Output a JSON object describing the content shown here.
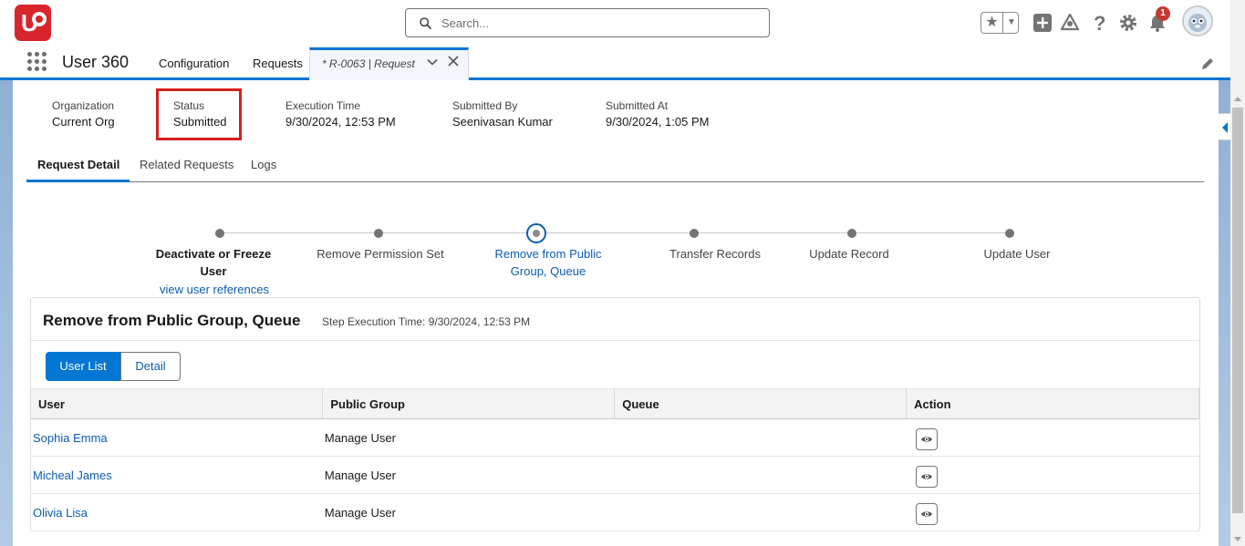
{
  "topbar": {
    "logo_text": "U",
    "search_placeholder": "Search...",
    "notification_count": "1"
  },
  "nav": {
    "app_name": "User 360",
    "items": [
      "Configuration",
      "Requests"
    ],
    "active_tab": "* R-0063 | Request"
  },
  "header": {
    "fields": [
      {
        "label": "Organization",
        "value": "Current Org"
      },
      {
        "label": "Status",
        "value": "Submitted"
      },
      {
        "label": "Execution Time",
        "value": "9/30/2024, 12:53 PM"
      },
      {
        "label": "Submitted By",
        "value": "Seenivasan Kumar"
      },
      {
        "label": "Submitted At",
        "value": "9/30/2024, 1:05 PM"
      }
    ]
  },
  "tabs": [
    "Request Detail",
    "Related Requests",
    "Logs"
  ],
  "path": {
    "steps": [
      {
        "label": "Deactivate or Freeze User",
        "state": "done"
      },
      {
        "label": "Remove Permission Set",
        "state": "pending"
      },
      {
        "label": "Remove from Public Group, Queue",
        "state": "current"
      },
      {
        "label": "Transfer Records",
        "state": "pending"
      },
      {
        "label": "Update Record",
        "state": "pending"
      },
      {
        "label": "Update User",
        "state": "pending"
      }
    ],
    "step1_link": "view user references"
  },
  "card": {
    "title": "Remove from Public Group, Queue",
    "subtitle": "Step Execution Time: 9/30/2024, 12:53 PM",
    "toggle": [
      "User List",
      "Detail"
    ],
    "columns": [
      "User",
      "Public Group",
      "Queue",
      "Action"
    ],
    "rows": [
      {
        "user": "Sophia Emma",
        "public_group": "Manage User",
        "queue": ""
      },
      {
        "user": "Micheal James",
        "public_group": "Manage User",
        "queue": ""
      },
      {
        "user": "Olivia Lisa",
        "public_group": "Manage User",
        "queue": ""
      }
    ]
  }
}
